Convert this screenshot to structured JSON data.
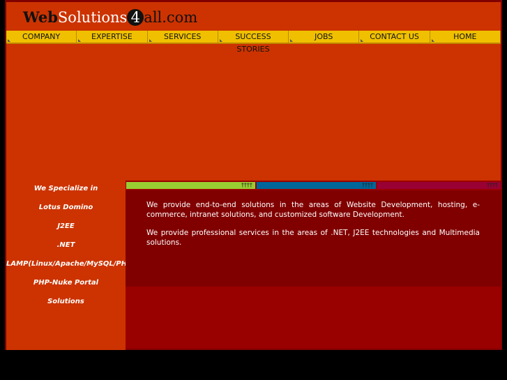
{
  "logo": {
    "part1": "Web",
    "part2": "Solutions",
    "part3": "4",
    "part4": "all.com"
  },
  "nav": [
    "COMPANY",
    "EXPERTISE",
    "SERVICES",
    "SUCCESS STORIES",
    "JOBS",
    "CONTACT US",
    "HOME"
  ],
  "specialize": [
    "We Specialize in",
    "Lotus Domino",
    "J2EE",
    ".NET",
    "LAMP(Linux/Apache/MySQL/PHP)",
    "PHP-Nuke Portal",
    "Solutions"
  ],
  "bars": [
    {
      "color": "#99cc33",
      "mark": "††††"
    },
    {
      "color": "#006699",
      "mark": "††††"
    },
    {
      "color": "#990033",
      "mark": "††††"
    }
  ],
  "content": [
    "We provide end-to-end solutions in the areas of Website Development, hosting, e-commerce, intranet solutions, and customized software Development.",
    "We provide professional services in the areas of .NET, J2EE technologies and Multimedia solutions."
  ]
}
